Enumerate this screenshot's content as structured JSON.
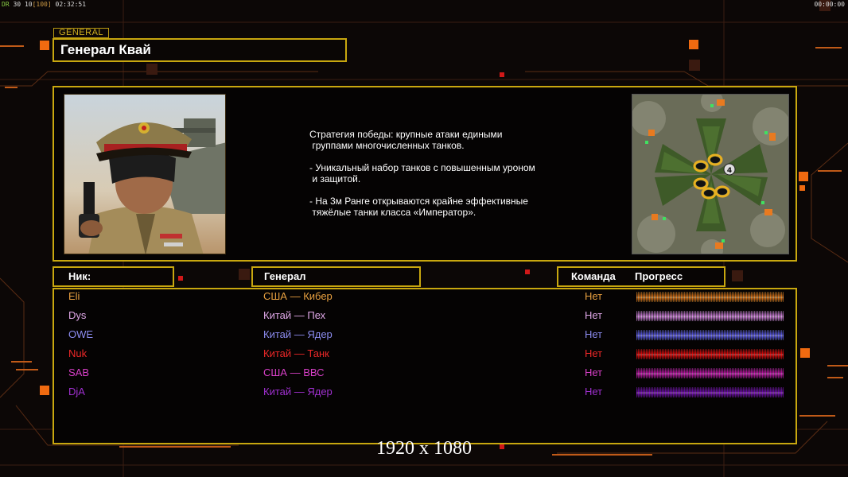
{
  "hud": {
    "left_a": "DR",
    "left_b": "30",
    "left_c": "10",
    "left_d": "[100]",
    "left_time": "02:32:51",
    "right_time": "00:00:00"
  },
  "general": {
    "tag": "GENERAL",
    "name": "Генерал Квай"
  },
  "description": [
    "Стратегия победы: крупные атаки едиными\n группами многочисленных танков.",
    "- Уникальный набор танков с повышенным уроном\n и защитой.",
    "- На 3м Ранге открываются крайне эффективные\n тяжёлые танки класса «Император»."
  ],
  "minimap": {
    "player_count_label": "4"
  },
  "headers": {
    "nick": "Ник:",
    "general": "Генерал",
    "team": "Команда",
    "progress": "Прогресс"
  },
  "players": [
    {
      "nick": "Eli",
      "general": "США — Кибер",
      "team": "Нет",
      "color": "#e8a040",
      "progress": 1.0
    },
    {
      "nick": "Dys",
      "general": "Китай — Пех",
      "team": "Нет",
      "color": "#e0a8e8",
      "progress": 1.0
    },
    {
      "nick": "OWE",
      "general": "Китай — Ядер",
      "team": "Нет",
      "color": "#8c8cf0",
      "progress": 1.0
    },
    {
      "nick": "Nuk",
      "general": "Китай — Танк",
      "team": "Нет",
      "color": "#ee2828",
      "progress": 1.0
    },
    {
      "nick": "SAB",
      "general": "США — ВВС",
      "team": "Нет",
      "color": "#d840c8",
      "progress": 1.0
    },
    {
      "nick": "DjA",
      "general": "Китай — Ядер",
      "team": "Нет",
      "color": "#a030d0",
      "progress": 1.0
    }
  ],
  "resolution_label": "1920 x 1080"
}
